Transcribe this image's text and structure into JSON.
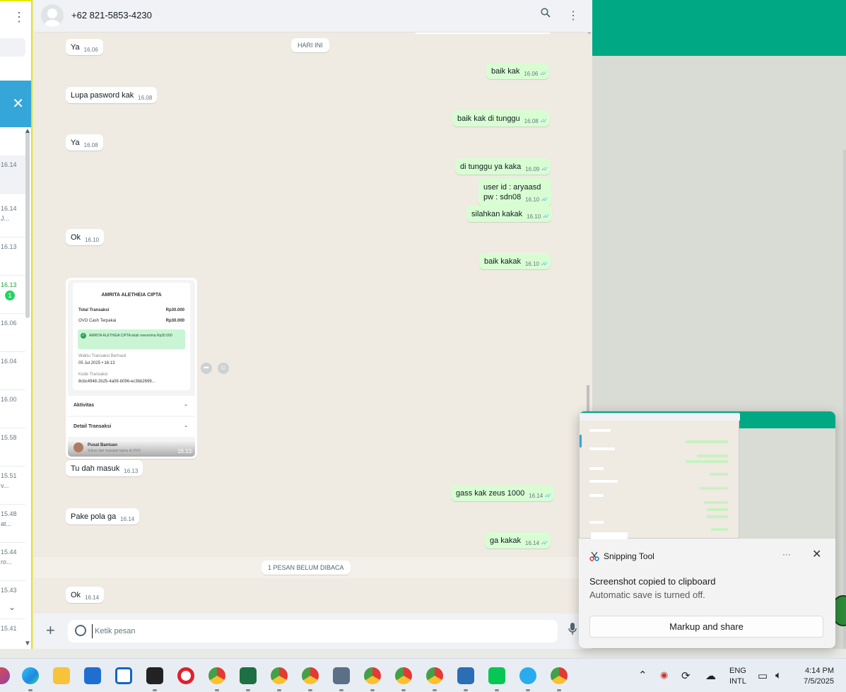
{
  "header": {
    "contact": "+62 821-5853-4230"
  },
  "sidebar": {
    "rows": [
      {
        "time": "16.14",
        "sub": "",
        "hl": true
      },
      {
        "time": "16.14",
        "sub": "J..."
      },
      {
        "time": "16.13",
        "sub": ""
      },
      {
        "time": "16.13",
        "sub": "",
        "badge": "1",
        "green": true
      },
      {
        "time": "16.06",
        "sub": ""
      },
      {
        "time": "16.04",
        "sub": ""
      },
      {
        "time": "16.00",
        "sub": ""
      },
      {
        "time": "15.58",
        "sub": ""
      },
      {
        "time": "15.51",
        "sub": "v..."
      },
      {
        "time": "15.48",
        "sub": "at..."
      },
      {
        "time": "15.44",
        "sub": "ro..."
      },
      {
        "time": "15.43",
        "sub": ""
      },
      {
        "time": "15.41",
        "sub": ""
      }
    ]
  },
  "messages": {
    "day_pill": "HARI INI",
    "unread_pill": "1 PESAN BELUM DIBACA",
    "items": [
      {
        "dir": "in",
        "text": "Ya",
        "time": "16.06"
      },
      {
        "dir": "out",
        "text": "baik kak",
        "time": "16.06"
      },
      {
        "dir": "in",
        "text": "Lupa pasword kak",
        "time": "16.08"
      },
      {
        "dir": "out",
        "text": "baik kak di tunggu",
        "time": "16.08"
      },
      {
        "dir": "in",
        "text": "Ya",
        "time": "16.08"
      },
      {
        "dir": "out",
        "text": "di tunggu ya kaka",
        "time": "16.09"
      },
      {
        "dir": "out",
        "line1": "user id : aryaasd",
        "line2": "pw : sdn08",
        "time": "16.10"
      },
      {
        "dir": "out",
        "text": "silahkan kakak",
        "time": "16.10"
      },
      {
        "dir": "in",
        "text": "Ok",
        "time": "16.10"
      },
      {
        "dir": "out",
        "text": "baik kakak",
        "time": "16.10"
      },
      {
        "dir": "in",
        "text": "Tu dah masuk",
        "time": "16.13"
      },
      {
        "dir": "out",
        "text": "gass kak zeus 1000",
        "time": "16.14"
      },
      {
        "dir": "in",
        "text": "Pake pola ga",
        "time": "16.14"
      },
      {
        "dir": "out",
        "text": "ga kakak",
        "time": "16.14"
      },
      {
        "dir": "in",
        "text": "Ok",
        "time": "16.14"
      }
    ],
    "receipt": {
      "title": "AMRITA ALETHEIA CIPTA",
      "total_label": "Total Transaksi",
      "total_value": "Rp30.000",
      "ovo_label": "OVO Cash Terpakai",
      "ovo_value": "Rp30.000",
      "success": "AMRITA ALETHEIA CIPTA telah menerima Rp30.000",
      "time_label": "Waktu Transaksi Berhasil",
      "time_value": "05 Jul 2025 • 16:13",
      "code_label": "Kode Transaksi",
      "code_value": "8cbc4948-2b25-4a08-b096-ec3bb2699...",
      "activity": "Aktivitas",
      "detail": "Detail Transaksi",
      "help": "Pusat Bantuan",
      "help_sub": "Solusi dari masalah kamu di OVO",
      "timestamp": "16.13"
    }
  },
  "footer": {
    "placeholder": "Ketik pesan"
  },
  "toast": {
    "app": "Snipping Tool",
    "dots": "···",
    "message": "Screenshot copied to clipboard",
    "sub": "Automatic save is turned off.",
    "button": "Markup and share"
  },
  "taskbar": {
    "lang1": "ENG",
    "lang2": "INTL",
    "time": "4:14 PM",
    "date": "7/5/2025"
  },
  "colors": {
    "wa_green": "#00a884",
    "out_bubble": "#d9fdd3",
    "chat_bg": "#efeae2",
    "tick_blue": "#53bdeb"
  }
}
